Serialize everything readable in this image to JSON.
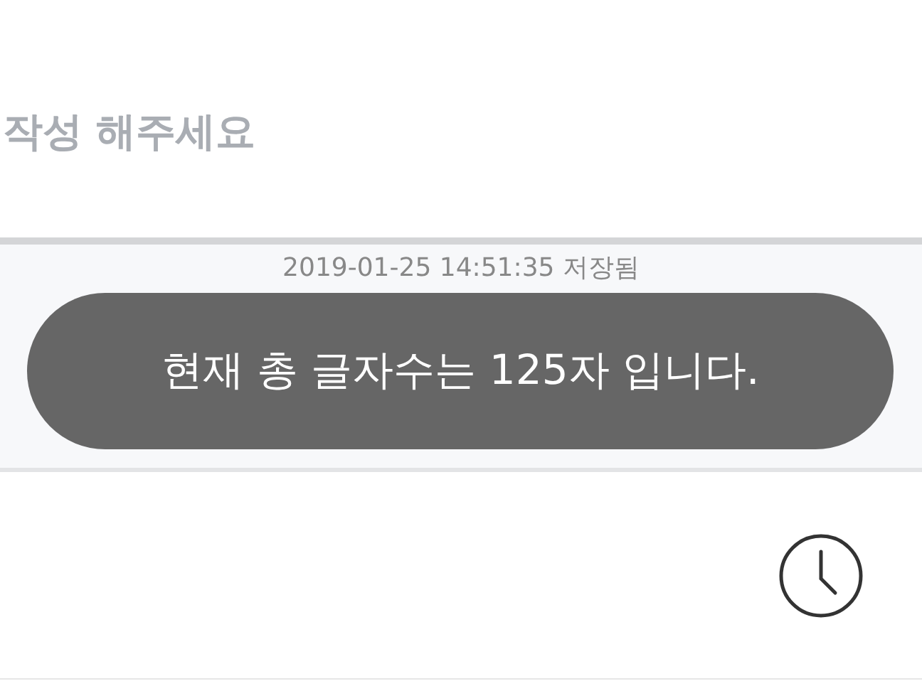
{
  "editor": {
    "placeholder": "작성 해주세요"
  },
  "save_status": "2019-01-25 14:51:35 저장됨",
  "toast": "현재 총 글자수는 125자 입니다."
}
